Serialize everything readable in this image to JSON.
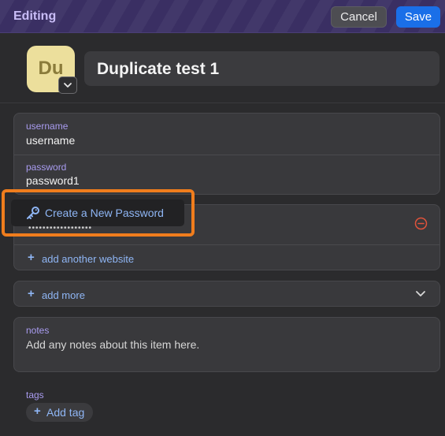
{
  "header": {
    "title": "Editing",
    "cancel_label": "Cancel",
    "save_label": "Save"
  },
  "item": {
    "avatar_initials": "Du",
    "title": "Duplicate test 1"
  },
  "fields": [
    {
      "label": "username",
      "value": "username"
    },
    {
      "label": "password",
      "value": "password1"
    }
  ],
  "website": {
    "remove_icon": "minus-circle-icon",
    "add_label": "add another website"
  },
  "popover": {
    "icon": "key-icon",
    "label": "Create a New Password"
  },
  "add_more": {
    "label": "add more",
    "icon": "chevron-down-icon"
  },
  "notes": {
    "label": "notes",
    "placeholder": "Add any notes about this item here."
  },
  "tags": {
    "label": "tags",
    "add_label": "Add tag"
  },
  "colors": {
    "accent": "#a99cf0",
    "link": "#8fb6f5",
    "save": "#1a6fe8",
    "highlight": "#f07d1d",
    "danger": "#e0533b"
  }
}
